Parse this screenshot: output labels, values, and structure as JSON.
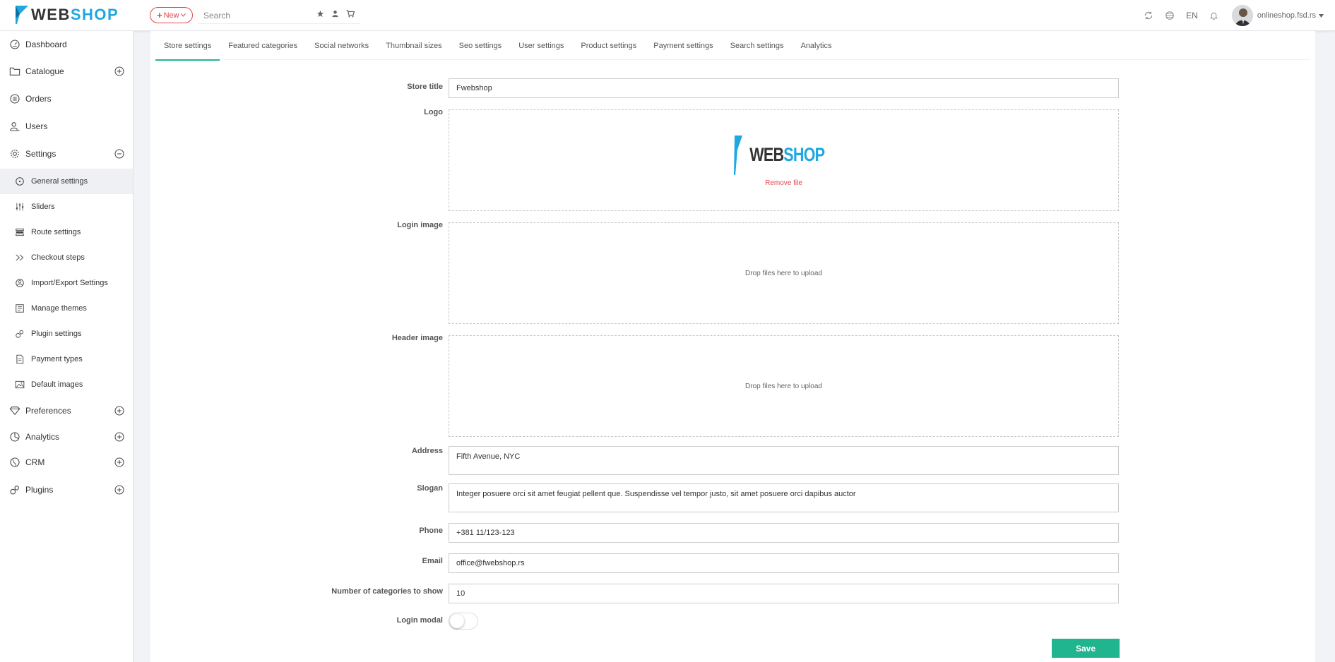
{
  "header": {
    "logo_web": "WEB",
    "logo_shop": "SHOP",
    "new_label": "New",
    "search_placeholder": "Search",
    "language": "EN",
    "user": "onlineshop.fsd.rs"
  },
  "sidebar": {
    "items": [
      {
        "label": "Dashboard",
        "icon": "dashboard-icon"
      },
      {
        "label": "Catalogue",
        "icon": "folder-icon"
      },
      {
        "label": "Orders",
        "icon": "list-icon"
      },
      {
        "label": "Users",
        "icon": "users-icon"
      },
      {
        "label": "Settings",
        "icon": "gear-icon"
      },
      {
        "label": "Preferences",
        "icon": "diamond-icon"
      },
      {
        "label": "Analytics",
        "icon": "pie-chart-icon"
      },
      {
        "label": "CRM",
        "icon": "globe-icon"
      },
      {
        "label": "Plugins",
        "icon": "plugin-icon"
      }
    ],
    "settings_sub": [
      {
        "label": "General settings",
        "active": true
      },
      {
        "label": "Sliders"
      },
      {
        "label": "Route settings"
      },
      {
        "label": "Checkout steps"
      },
      {
        "label": "Import/Export Settings"
      },
      {
        "label": "Manage themes"
      },
      {
        "label": "Plugin settings"
      },
      {
        "label": "Payment types"
      },
      {
        "label": "Default images"
      }
    ]
  },
  "tabs": [
    "Store settings",
    "Featured categories",
    "Social networks",
    "Thumbnail sizes",
    "Seo settings",
    "User settings",
    "Product settings",
    "Payment settings",
    "Search settings",
    "Analytics"
  ],
  "form": {
    "store_title_label": "Store title",
    "store_title_value": "Fwebshop",
    "logo_label": "Logo",
    "logo_preview_web": "WEB",
    "logo_preview_shop": "SHOP",
    "remove_file": "Remove file",
    "login_image_label": "Login image",
    "header_image_label": "Header image",
    "drop_text": "Drop files here to upload",
    "address_label": "Address",
    "address_value": "Fifth Avenue, NYC",
    "slogan_label": "Slogan",
    "slogan_value": "Integer posuere orci sit amet feugiat pellent que. Suspendisse vel tempor justo, sit amet posuere orci dapibus auctor",
    "phone_label": "Phone",
    "phone_value": "+381 11/123-123",
    "email_label": "Email",
    "email_value": "office@fwebshop.rs",
    "categories_label": "Number of categories to show",
    "categories_value": "10",
    "login_modal_label": "Login modal",
    "login_modal_on": false,
    "save_label": "Save"
  },
  "colors": {
    "accent": "#20b48f",
    "danger": "#e0474c",
    "brand_blue": "#1ea7e1"
  }
}
